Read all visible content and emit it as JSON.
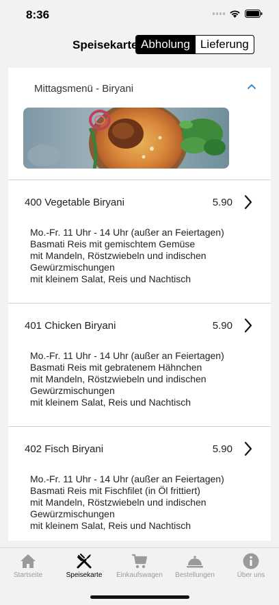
{
  "status_bar": {
    "time": "8:36"
  },
  "header": {
    "title": "Speisekarte",
    "segments": [
      "Abholung",
      "Lieferung"
    ],
    "active_segment": "Abholung"
  },
  "section": {
    "title": "Mittagsmenü - Biryani",
    "expanded": true,
    "image": "biryani-dish-image"
  },
  "items": [
    {
      "name": "400 Vegetable Biryani",
      "price": "5.90",
      "description": [
        "Mo.-Fr. 11 Uhr - 14 Uhr (außer an Feiertagen)",
        "Basmati Reis mit gemischtem Gemüse",
        "mit Mandeln, Röstzwiebeln und indischen",
        "Gewürzmischungen",
        "mit kleinem Salat, Reis und Nachtisch"
      ]
    },
    {
      "name": "401 Chicken Biryani",
      "price": "5.90",
      "description": [
        "Mo.-Fr. 11 Uhr - 14 Uhr (außer an Feiertagen)",
        "Basmati Reis mit gebratenem Hähnchen",
        "mit Mandeln, Röstzwiebeln und indischen",
        "Gewürzmischungen",
        "mit kleinem Salat, Reis und Nachtisch"
      ]
    },
    {
      "name": "402 Fisch Biryani",
      "price": "5.90",
      "description": [
        "Mo.-Fr. 11 Uhr - 14 Uhr (außer an Feiertagen)",
        "Basmati Reis mit Fischfilet (in Öl frittiert)",
        "mit Mandeln, Röstzwiebeln und indischen",
        "Gewürzmischungen",
        "mit kleinem Salat, Reis und Nachtisch"
      ]
    }
  ],
  "tabbar": {
    "tabs": [
      {
        "label": "Startseite",
        "icon": "home-icon"
      },
      {
        "label": "Speisekarte",
        "icon": "fork-knife-icon"
      },
      {
        "label": "Einkaufswagen",
        "icon": "cart-icon"
      },
      {
        "label": "Bestellungen",
        "icon": "cloche-icon"
      },
      {
        "label": "Über uns",
        "icon": "info-icon"
      }
    ],
    "active": "Speisekarte"
  },
  "colors": {
    "accent": "#2f8fcf",
    "active_tab": "#000000",
    "inactive_tab": "#9a9a9a"
  }
}
